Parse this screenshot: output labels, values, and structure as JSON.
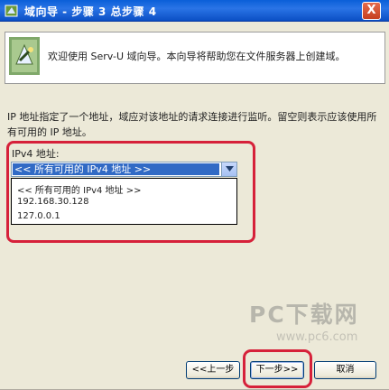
{
  "window": {
    "title": "域向导 - 步骤 3 总步骤 4",
    "close_label": "X"
  },
  "header": {
    "welcome_text": "欢迎使用 Serv-U 域向导。本向导将帮助您在文件服务器上创建域。"
  },
  "main": {
    "description": "IP 地址指定了一个地址，域应对该地址的请求连接进行监听。留空则表示应该使用所有可用的 IP 地址。",
    "ipv4_label": "IPv4 地址:",
    "ip_select": {
      "selected": "<< 所有可用的 IPv4 地址 >>"
    },
    "ip_options": [
      "<< 所有可用的 IPv4 地址 >>",
      "192.168.30.128",
      "127.0.0.1"
    ]
  },
  "buttons": {
    "back": "<<上一步",
    "next": "下一步>>",
    "cancel": "取消"
  },
  "watermark": {
    "text": "PC下载网",
    "url": "www.pc6.com"
  },
  "colors": {
    "titlebar": "#0a5fd8",
    "highlight_frame": "#d6213a",
    "selection": "#316ac5"
  }
}
